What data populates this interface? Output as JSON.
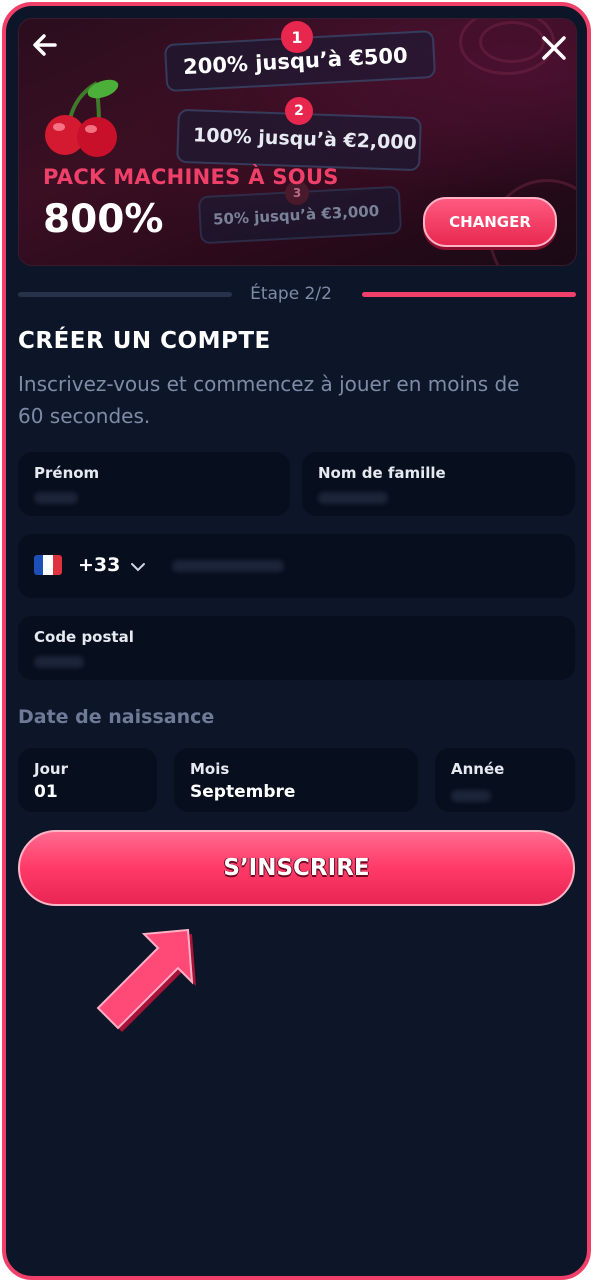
{
  "banner": {
    "back_icon": "arrow-left-icon",
    "close_icon": "close-icon",
    "fruit_icon": "cherries-icon",
    "tiers": [
      {
        "num": "1",
        "label": "200% jusqu’à €500"
      },
      {
        "num": "2",
        "label": "100% jusqu’à €2,000"
      },
      {
        "num": "3",
        "label": "50% jusqu’à €3,000"
      }
    ],
    "pack_title": "PACK MACHINES À SOUS",
    "percent": "800%",
    "change_label": "CHANGER"
  },
  "steps": {
    "label": "Étape 2/2",
    "progress": 1.0
  },
  "form": {
    "title": "CRÉER UN COMPTE",
    "subtitle": "Inscrivez-vous et commencez à jouer en moins de 60 secondes.",
    "first_name_label": "Prénom",
    "last_name_label": "Nom de famille",
    "phone_flag": "france-flag-icon",
    "phone_code": "+33",
    "postal_label": "Code postal",
    "dob_label": "Date de naissance",
    "day_label": "Jour",
    "day_value": "01",
    "month_label": "Mois",
    "month_value": "Septembre",
    "year_label": "Année",
    "submit_label": "S’INSCRIRE"
  },
  "colors": {
    "accent": "#f0406a",
    "background": "#0d1628",
    "field": "#070e1e",
    "muted_text": "#7f8aa6"
  }
}
